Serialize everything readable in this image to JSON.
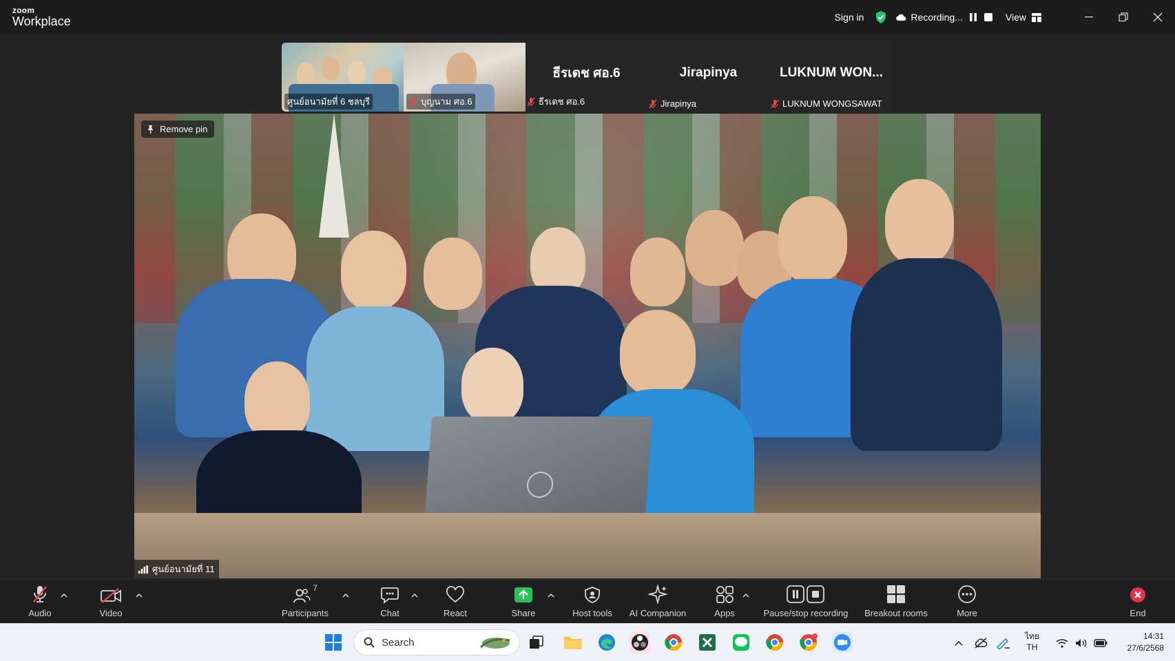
{
  "app": {
    "brand_top": "zoom",
    "brand_main": "Workplace"
  },
  "titlebar": {
    "sign_in": "Sign in",
    "recording_status": "Recording...",
    "view_label": "View"
  },
  "strip": {
    "tiles": [
      {
        "type": "video",
        "caption": "ศูนย์อนามัยที่ 6 ชลบุรี",
        "muted": false
      },
      {
        "type": "video",
        "caption": "บุญนาม ศอ.6",
        "muted": true
      },
      {
        "type": "name",
        "big_name": "ธีรเดช ศอ.6",
        "caption": "ธีรเดช ศอ.6",
        "muted": true
      },
      {
        "type": "name",
        "big_name": "Jirapinya",
        "caption": "Jirapinya",
        "muted": true
      },
      {
        "type": "name",
        "big_name": "LUKNUM WON...",
        "caption": "LUKNUM WONGSAWAT",
        "muted": true
      }
    ]
  },
  "main_video": {
    "remove_pin": "Remove pin",
    "participant_label": "ศูนย์อนามัยที่ 11"
  },
  "toolbar": {
    "audio": "Audio",
    "video": "Video",
    "participants": "Participants",
    "participant_count": "7",
    "chat": "Chat",
    "react": "React",
    "share": "Share",
    "host_tools": "Host tools",
    "ai_companion": "AI Companion",
    "apps": "Apps",
    "pause_stop_recording": "Pause/stop recording",
    "breakout_rooms": "Breakout rooms",
    "more": "More",
    "end": "End"
  },
  "taskbar": {
    "search_placeholder": "Search",
    "lang_top": "ไทย",
    "lang_bottom": "TH",
    "time": "14:31",
    "date": "27/6/2568"
  },
  "colors": {
    "share_green": "#2bbf5a",
    "end_red": "#e0334a",
    "muted_red": "#e5484d",
    "shield_green": "#27c266"
  }
}
